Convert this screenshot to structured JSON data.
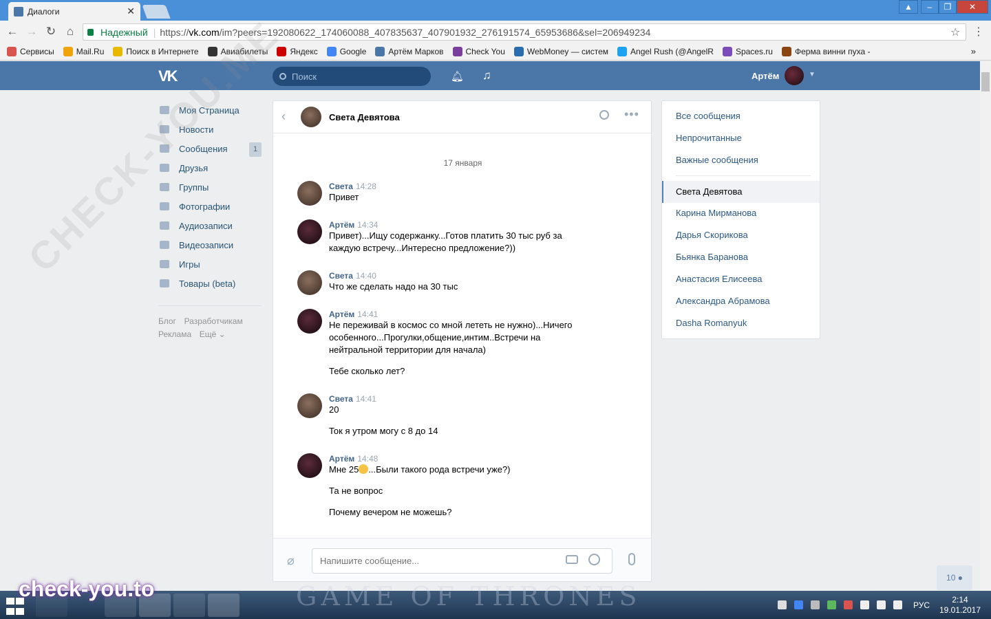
{
  "browser": {
    "tab_title": "Диалоги",
    "secure_label": "Надежный",
    "url_prefix": "https://",
    "url_host": "vk.com",
    "url_path": "/im?peers=192080622_174060088_407835637_407901932_276191574_65953686&sel=206949234",
    "bookmarks": [
      "Сервисы",
      "Mail.Ru",
      "Поиск в Интернете",
      "Авиабилеты",
      "Яндекс",
      "Google",
      "Артём Марков",
      "Check You",
      "WebMoney — систем",
      "Angel Rush (@AngelR",
      "Spaces.ru",
      "Ферма винни пуха -"
    ],
    "bookmark_colors": [
      "#d9534f",
      "#f0a30a",
      "#e6b800",
      "#333333",
      "#cc0000",
      "#4285f4",
      "#4a76a8",
      "#7a3e9d",
      "#2a6cb0",
      "#1da1f2",
      "#7b4bb8",
      "#8b4513"
    ]
  },
  "vk": {
    "logo": "VK",
    "search_placeholder": "Поиск",
    "user_name": "Артём"
  },
  "left_nav": {
    "items": [
      {
        "label": "Моя Страница",
        "icon": "home-icon"
      },
      {
        "label": "Новости",
        "icon": "news-icon"
      },
      {
        "label": "Сообщения",
        "icon": "messages-icon",
        "badge": "1"
      },
      {
        "label": "Друзья",
        "icon": "friends-icon"
      },
      {
        "label": "Группы",
        "icon": "groups-icon"
      },
      {
        "label": "Фотографии",
        "icon": "photos-icon"
      },
      {
        "label": "Аудиозаписи",
        "icon": "audio-icon"
      },
      {
        "label": "Видеозаписи",
        "icon": "video-icon"
      },
      {
        "label": "Игры",
        "icon": "games-icon"
      },
      {
        "label": "Товары (beta)",
        "icon": "market-icon"
      }
    ],
    "footer": [
      "Блог",
      "Разработчикам",
      "Реклама",
      "Ещё ⌄"
    ]
  },
  "dialog": {
    "contact_name": "Света Девятова",
    "date": "17 января",
    "messages": [
      {
        "author": "Света",
        "time": "14:28",
        "lines": [
          "Привет"
        ]
      },
      {
        "author": "Артём",
        "time": "14:34",
        "lines": [
          "Привет)...Ищу содержанку...Готов платить 30 тыс руб за",
          "каждую встречу...Интересно предложение?))"
        ]
      },
      {
        "author": "Света",
        "time": "14:40",
        "lines": [
          "Что же сделать надо на 30 тыс"
        ]
      },
      {
        "author": "Артём",
        "time": "14:41",
        "lines": [
          "Не переживай в космос со мной лететь не нужно)...Ничего",
          "особенного...Прогулки,общение,интим..Встречи на",
          "нейтральной территории для начала)"
        ],
        "extra": [
          "Тебе сколько лет?"
        ]
      },
      {
        "author": "Света",
        "time": "14:41",
        "lines": [
          "20"
        ],
        "extra": [
          "Ток я утром могу с 8 до 14"
        ]
      },
      {
        "author": "Артём",
        "time": "14:48",
        "line_before_emoji": "Мне 25",
        "line_after_emoji": "...Были такого рода встречи уже?)",
        "extra": [
          "Та не вопрос",
          "Почему вечером не можешь?"
        ]
      }
    ],
    "compose_placeholder": "Напишите сообщение..."
  },
  "right_panel": {
    "filters": [
      "Все сообщения",
      "Непрочитанные",
      "Важные сообщения"
    ],
    "active_dialog": "Света Девятова",
    "dialogs": [
      "Карина Мирманова",
      "Дарья Скорикова",
      "Бьянка Баранова",
      "Анастасия Елисеева",
      "Александра Абрамова",
      "Dasha Romanyuk"
    ]
  },
  "online_count": "10",
  "taskbar": {
    "lang": "РУС",
    "time": "2:14",
    "date": "19.01.2017",
    "banner": "GAME OF THRONES"
  },
  "watermarks": {
    "bottom": "check-you.to",
    "diagonal": "CHECK-YOU.ME"
  }
}
